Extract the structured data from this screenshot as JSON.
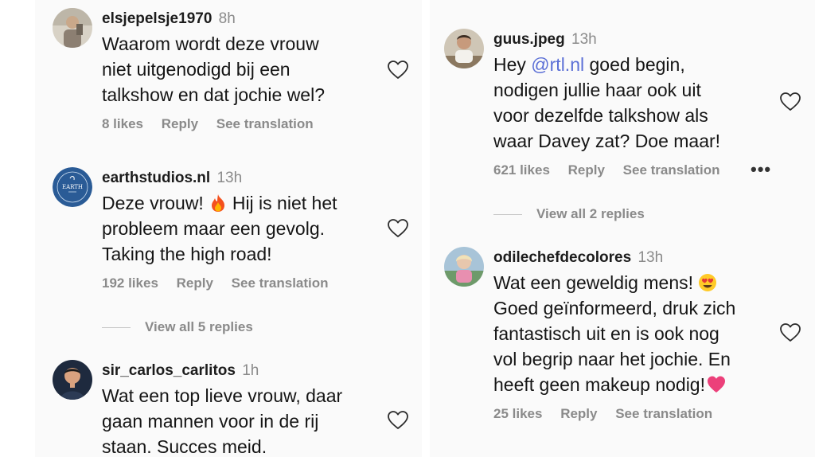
{
  "left_column": {
    "comments": [
      {
        "username": "elsjepelsje1970",
        "time": "8h",
        "lines": [
          "Waarom wordt deze vrouw",
          "niet uitgenodigd bij een",
          "talkshow en dat jochie wel?"
        ],
        "likes": "8 likes",
        "reply": "Reply",
        "translate": "See translation"
      },
      {
        "username": "earthstudios.nl",
        "time": "13h",
        "line1_before": "Deze vrouw!",
        "line1_after": "Hij is niet het",
        "lines_rest": [
          "probleem maar een gevolg.",
          "Taking the high road!"
        ],
        "likes": "192 likes",
        "reply": "Reply",
        "translate": "See translation",
        "avatar_text": "EARTH",
        "view_replies": "View all 5 replies"
      },
      {
        "username": "sir_carlos_carlitos",
        "time": "1h",
        "lines": [
          "Wat een top lieve vrouw, daar",
          "gaan mannen voor in de rij",
          "staan. Succes meid."
        ]
      }
    ]
  },
  "right_column": {
    "comments": [
      {
        "username": "guus.jpeg",
        "time": "13h",
        "line1_prefix": "Hey",
        "mention": "@rtl.nl",
        "line1_suffix": "goed begin,",
        "lines_rest": [
          "nodigen jullie haar ook uit",
          "voor dezelfde talkshow als",
          "waar Davey zat? Doe maar!"
        ],
        "likes": "621 likes",
        "reply": "Reply",
        "translate": "See translation",
        "more": "•••",
        "view_replies": "View all 2 replies"
      },
      {
        "username": "odilechefdecolores",
        "time": "13h",
        "line1": "Wat een geweldig mens!",
        "lines_mid": [
          "Goed geïnformeerd, druk zich",
          "fantastisch uit en is ook nog",
          "vol begrip naar het jochie. En"
        ],
        "line_last": "heeft geen makeup nodig!",
        "likes": "25 likes",
        "reply": "Reply",
        "translate": "See translation"
      }
    ]
  },
  "icons": [
    "heart-outline-icon",
    "fire-emoji-icon",
    "heart-eyes-emoji-icon",
    "pink-heart-emoji-icon",
    "more-options-icon"
  ],
  "colors": {
    "mention": "#5b6fd6",
    "muted": "#8a8a8a",
    "earth_avatar": "#2a5b96"
  }
}
